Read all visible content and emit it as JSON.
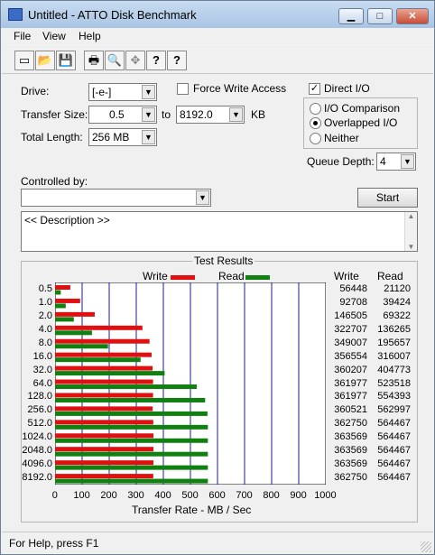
{
  "window": {
    "title": "Untitled - ATTO Disk Benchmark"
  },
  "title_buttons": {
    "minimize": "▁",
    "maximize": "□",
    "close": "✕"
  },
  "menu": [
    "File",
    "View",
    "Help"
  ],
  "toolbar_icons": [
    "new-icon",
    "open-icon",
    "save-icon",
    "print-icon",
    "print-preview-icon",
    "move-icon",
    "help-icon",
    "context-help-icon"
  ],
  "toolbar_glyphs": {
    "new": "▭",
    "open": "📂",
    "save": "💾",
    "print": "🖶",
    "preview": "🔍",
    "move": "✥",
    "help": "?",
    "context_help": "?"
  },
  "form": {
    "drive_label": "Drive:",
    "drive_value": "[-e-]",
    "force_write_label": "Force Write Access",
    "force_write_checked": false,
    "direct_io_label": "Direct I/O",
    "direct_io_checked": true,
    "direct_io_mark": "✓",
    "transfer_size_label": "Transfer Size:",
    "transfer_from": "0.5",
    "to_label": "to",
    "transfer_to": "8192.0",
    "kb_label": "KB",
    "total_length_label": "Total Length:",
    "total_length_value": "256 MB",
    "io_options": [
      "I/O Comparison",
      "Overlapped I/O",
      "Neither"
    ],
    "io_selected": "Overlapped I/O",
    "queue_depth_label": "Queue Depth:",
    "queue_depth_value": "4",
    "controlled_by_label": "Controlled by:",
    "controlled_by_value": "",
    "start_label": "Start",
    "description_text": "<< Description >>",
    "arrow": "▼",
    "scroll_up": "▲",
    "scroll_down": "▼"
  },
  "results": {
    "group_title": "Test Results",
    "write_label": "Write",
    "read_label": "Read",
    "col_write": "Write",
    "col_read": "Read",
    "write_color": "#e01010",
    "read_color": "#108010",
    "axis_label": "Transfer Rate - MB / Sec"
  },
  "chart_data": {
    "type": "bar",
    "orientation": "horizontal",
    "categories": [
      "0.5",
      "1.0",
      "2.0",
      "4.0",
      "8.0",
      "16.0",
      "32.0",
      "64.0",
      "128.0",
      "256.0",
      "512.0",
      "1024.0",
      "2048.0",
      "4096.0",
      "8192.0"
    ],
    "series": [
      {
        "name": "Write",
        "values": [
          56448,
          92708,
          146505,
          322707,
          349007,
          356554,
          360207,
          361977,
          361977,
          360521,
          362750,
          363569,
          363569,
          363569,
          362750
        ]
      },
      {
        "name": "Read",
        "values": [
          21120,
          39424,
          69322,
          136265,
          195657,
          316007,
          404773,
          523518,
          554393,
          562997,
          564467,
          564467,
          564467,
          564467,
          564467
        ]
      }
    ],
    "write_values_text": [
      "56448",
      "92708",
      "146505",
      "322707",
      "349007",
      "356554",
      "360207",
      "361977",
      "361977",
      "360521",
      "362750",
      "363569",
      "363569",
      "363569",
      "362750"
    ],
    "read_values_text": [
      "21120",
      "39424",
      "69322",
      "136265",
      "195657",
      "316007",
      "404773",
      "523518",
      "554393",
      "562997",
      "564467",
      "564467",
      "564467",
      "564467",
      "564467"
    ],
    "ticks": [
      "0",
      "100",
      "200",
      "300",
      "400",
      "500",
      "600",
      "700",
      "800",
      "900",
      "1000"
    ],
    "xlim": [
      0,
      1000
    ],
    "xlabel": "Transfer Rate - MB / Sec",
    "legend_placement": "top",
    "grid": true
  },
  "status": {
    "text": "For Help, press F1"
  }
}
